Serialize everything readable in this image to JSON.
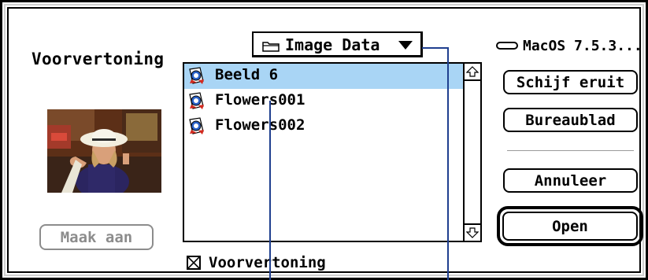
{
  "preview_label": "Voorvertoning",
  "create_button": "Maak aan",
  "folder_popup": {
    "label": "Image Data",
    "icon": "folder-icon"
  },
  "files": [
    {
      "name": "Beeld 6",
      "selected": true,
      "icon": "picture-file-icon"
    },
    {
      "name": "Flowers001",
      "selected": false,
      "icon": "picture-file-icon"
    },
    {
      "name": "Flowers002",
      "selected": false,
      "icon": "picture-file-icon"
    }
  ],
  "preview_checkbox": {
    "label": "Voorvertoning",
    "checked": true
  },
  "disk": {
    "label": "MacOS 7.5.3...",
    "icon": "disk-icon"
  },
  "buttons": {
    "eject": "Schijf eruit",
    "desktop": "Bureaublad",
    "cancel": "Annuleer",
    "open": "Open"
  },
  "colors": {
    "selection": "#a9d5f5",
    "callout_line": "#1f3f8f",
    "disabled": "#8c8c8c"
  }
}
